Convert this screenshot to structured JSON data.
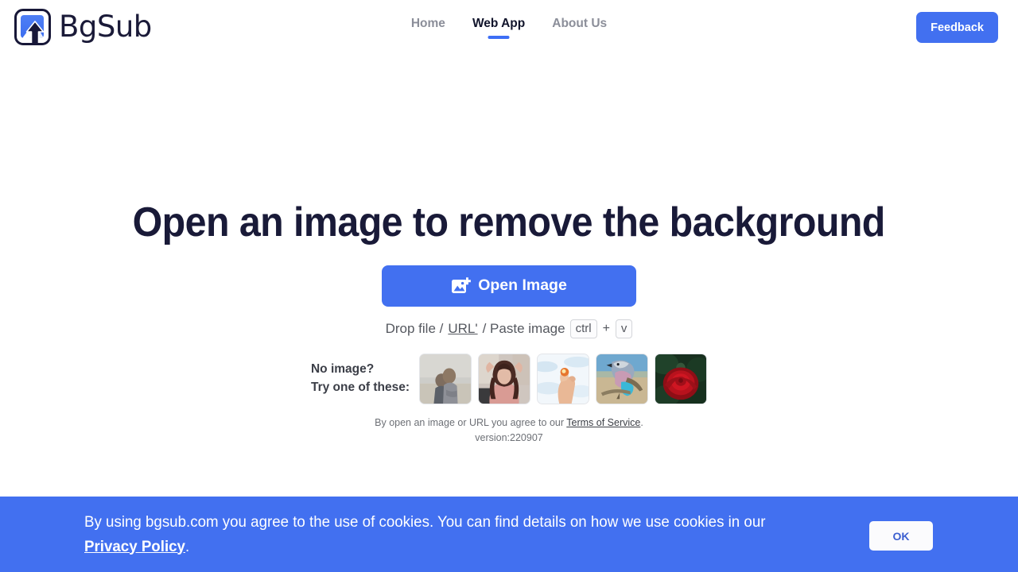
{
  "brand": {
    "name": "BgSub",
    "logo_icon": "mountain-image-upload-icon",
    "accent_color": "#4270f0",
    "dark_color": "#191a38"
  },
  "nav": {
    "items": [
      {
        "label": "Home",
        "active": false
      },
      {
        "label": "Web App",
        "active": true
      },
      {
        "label": "About Us",
        "active": false
      }
    ],
    "feedback_label": "Feedback"
  },
  "main": {
    "headline": "Open an image to remove the background",
    "open_button_label": "Open Image",
    "open_button_icon": "add-image-icon",
    "drop": {
      "prefix": "Drop file / ",
      "url_label": "URL'",
      "middle": " / Paste image",
      "key_ctrl": "ctrl",
      "key_plus": "+",
      "key_v": "v"
    },
    "samples": {
      "label_line1": "No image?",
      "label_line2": "Try one of these:",
      "thumbnails": [
        {
          "name": "couple-on-beach",
          "alt": "Couple standing back to back by the sea"
        },
        {
          "name": "woman-pink-sweater",
          "alt": "Woman with curly hair in pink sweater"
        },
        {
          "name": "hand-holding-object",
          "alt": "Hand holding a small orange object against sky"
        },
        {
          "name": "lilac-breasted-roller-bird",
          "alt": "Colorful bird perched on a branch"
        },
        {
          "name": "red-rose",
          "alt": "Red rose on dark green foliage"
        }
      ]
    },
    "legal": {
      "prefix": "By open an image or URL you agree to our ",
      "terms_label": "Terms of Service",
      "suffix": ".",
      "version": "version:220907"
    }
  },
  "cookie_banner": {
    "text_before": "By using bgsub.com you agree to the use of cookies. You can find details on how we use cookies in our ",
    "link_label": "Privacy Policy",
    "text_after": ".",
    "ok_label": "OK",
    "background_color": "#4270f0"
  }
}
